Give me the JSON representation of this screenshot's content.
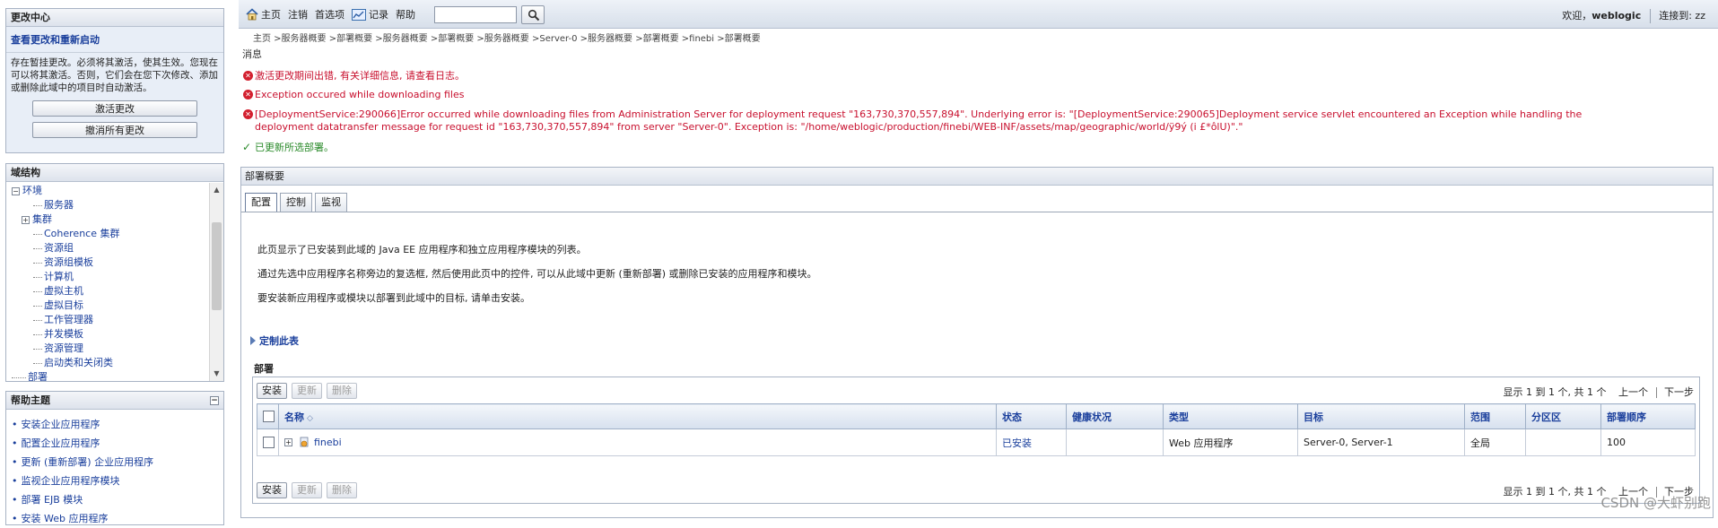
{
  "change_center": {
    "title": "更改中心",
    "link": "查看更改和重新启动",
    "text": "存在暂挂更改。必须将其激活，使其生效。您现在可以将其激活。否则，它们会在您下次修改、添加或删除此域中的项目时自动激活。",
    "activate_button": "激活更改",
    "undo_button": "撤消所有更改"
  },
  "domain_structure": {
    "title": "域结构",
    "items": [
      {
        "label": "环境",
        "level": 0,
        "expander": "−"
      },
      {
        "label": "服务器",
        "level": 1,
        "expander": ""
      },
      {
        "label": "集群",
        "level": 1,
        "expander": "+"
      },
      {
        "label": "Coherence 集群",
        "level": 1,
        "expander": ""
      },
      {
        "label": "资源组",
        "level": 1,
        "expander": ""
      },
      {
        "label": "资源组模板",
        "level": 1,
        "expander": ""
      },
      {
        "label": "计算机",
        "level": 1,
        "expander": ""
      },
      {
        "label": "虚拟主机",
        "level": 1,
        "expander": ""
      },
      {
        "label": "虚拟目标",
        "level": 1,
        "expander": ""
      },
      {
        "label": "工作管理器",
        "level": 1,
        "expander": ""
      },
      {
        "label": "并发模板",
        "level": 1,
        "expander": ""
      },
      {
        "label": "资源管理",
        "level": 1,
        "expander": ""
      },
      {
        "label": "启动类和关闭类",
        "level": 1,
        "expander": ""
      },
      {
        "label": "部署",
        "level": 0,
        "expander": ""
      }
    ]
  },
  "help_topics": {
    "title": "帮助主题",
    "collapse": "−",
    "items": [
      "安装企业应用程序",
      "配置企业应用程序",
      "更新 (重新部署) 企业应用程序",
      "监视企业应用程序模块",
      "部署 EJB 模块",
      "安装 Web 应用程序"
    ]
  },
  "topbar": {
    "home": "主页",
    "logout": "注销",
    "preferences": "首选项",
    "record": "记录",
    "help": "帮助",
    "search_value": "",
    "welcome_prefix": "欢迎，",
    "user": "weblogic",
    "connected": "连接到: zz"
  },
  "breadcrumb": "主页 >服务器概要 >部署概要 >服务器概要 >部署概要 >服务器概要 >Server-0 >服务器概要 >部署概要 >finebi >部署概要",
  "messages": {
    "title": "消息",
    "errors": [
      "激活更改期间出错, 有关详细信息, 请查看日志。",
      "Exception occured while downloading files",
      "[DeploymentService:290066]Error occurred while downloading files from Administration Server for deployment request \"163,730,370,557,894\". Underlying error is: \"[DeploymentService:290065]Deployment service servlet encountered an Exception while handling the deployment datatransfer message for request id \"163,730,370,557,894\" from server \"Server-0\". Exception is: \"/home/weblogic/production/finebi/WEB-INF/assets/map/geographic/world/ÿ9ý (i £*ôlU)\".\""
    ],
    "success": "已更新所选部署。"
  },
  "summary": {
    "title": "部署概要",
    "tabs": [
      "配置",
      "控制",
      "监视"
    ],
    "desc1": "此页显示了已安装到此域的 Java EE 应用程序和独立应用程序模块的列表。",
    "desc2": "通过先选中应用程序名称旁边的复选框, 然后使用此页中的控件, 可以从此域中更新 (重新部署) 或删除已安装的应用程序和模块。",
    "desc3": "要安装新应用程序或模块以部署到此域中的目标, 请单击安装。",
    "customize": "定制此表",
    "deployments_label": "部署",
    "buttons": {
      "install": "安装",
      "update": "更新",
      "delete": "删除"
    },
    "pager": {
      "info": "显示 1 到 1 个, 共 1 个",
      "prev": "上一个",
      "next": "下一步"
    },
    "columns": [
      "名称",
      "状态",
      "健康状况",
      "类型",
      "目标",
      "范围",
      "分区区",
      "部署顺序"
    ],
    "rows": [
      {
        "name": "finebi",
        "state": "已安装",
        "health": "",
        "type": "Web 应用程序",
        "targets": "Server-0, Server-1",
        "scope": "全局",
        "partition": "",
        "order": "100"
      }
    ]
  },
  "watermark": "CSDN @大虾别跑",
  "colors": {
    "link": "#1a3f9c",
    "error": "#c8102e",
    "success": "#2a8a2a"
  }
}
